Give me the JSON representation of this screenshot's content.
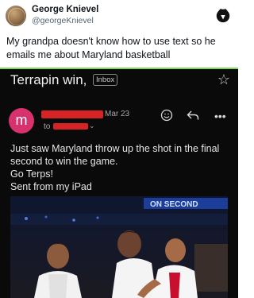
{
  "tweet": {
    "display_name": "George Knievel",
    "handle": "@georgeKnievel",
    "text_lines": [
      "My grandpa doesn't know how to use text so he",
      "emails me about Maryland basketball"
    ],
    "brand_icon": "draftkings-crown-logo"
  },
  "email": {
    "subject": "Terrapin win,",
    "badge": "Inbox",
    "sender_initial": "m",
    "date": "Mar 23",
    "to_label": "to",
    "body_lines": [
      "Just saw Maryland throw up the shot in the final",
      "second to win the game.",
      "Go Terps!",
      "Sent from my iPad"
    ],
    "photo_sign_text": "ON SECOND",
    "icons": [
      "star-icon",
      "emoji-icon",
      "reply-icon",
      "more-icon"
    ]
  },
  "colors": {
    "email_bg": "#0a0a0a",
    "sender_avatar": "#d8326e",
    "redaction": "#d62424",
    "divider": "#7ed957"
  }
}
